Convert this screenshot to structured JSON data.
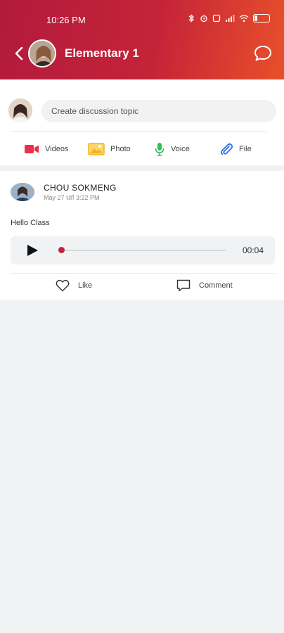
{
  "status_bar": {
    "time": "10:26 PM",
    "battery_level": 0.15
  },
  "header": {
    "back_icon": "chevron-left-icon",
    "title": "Elementary 1",
    "chat_icon": "chat-bubble-icon"
  },
  "composer": {
    "placeholder": "Create discussion topic",
    "actions": [
      {
        "label": "Videos",
        "icon": "video-camera-icon",
        "color": "#e8304a"
      },
      {
        "label": "Photo",
        "icon": "image-icon",
        "color": "#f2b322"
      },
      {
        "label": "Voice",
        "icon": "microphone-icon",
        "color": "#2fbf57"
      },
      {
        "label": "File",
        "icon": "paperclip-icon",
        "color": "#2f6fe0"
      }
    ]
  },
  "post": {
    "author": "CHOU SOKMENG",
    "date": "May 27 នៅ 3:22 PM",
    "text": "Hello Class",
    "audio": {
      "duration": "00:04",
      "progress": 0.0
    },
    "actions": {
      "like": "Like",
      "comment": "Comment"
    }
  },
  "colors": {
    "header_start": "#b21a3c",
    "header_end": "#e8502a",
    "accent": "#c42237"
  }
}
